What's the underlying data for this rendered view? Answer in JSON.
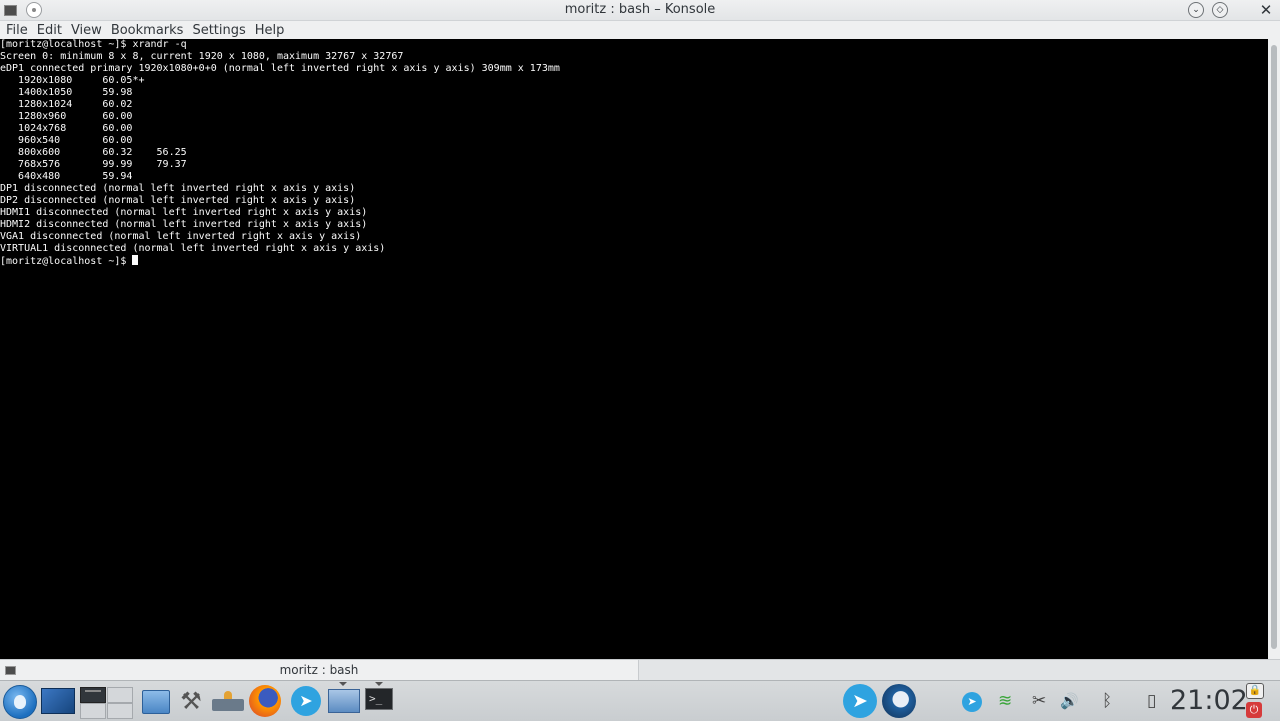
{
  "window": {
    "title": "moritz : bash – Konsole",
    "close_glyph": "✕",
    "minimize_glyph": "⌄",
    "maximize_glyph": "◇"
  },
  "menubar": {
    "items": [
      "File",
      "Edit",
      "View",
      "Bookmarks",
      "Settings",
      "Help"
    ]
  },
  "terminal": {
    "lines": [
      "[moritz@localhost ~]$ xrandr -q",
      "Screen 0: minimum 8 x 8, current 1920 x 1080, maximum 32767 x 32767",
      "eDP1 connected primary 1920x1080+0+0 (normal left inverted right x axis y axis) 309mm x 173mm",
      "   1920x1080     60.05*+",
      "   1400x1050     59.98",
      "   1280x1024     60.02",
      "   1280x960      60.00",
      "   1024x768      60.00",
      "   960x540       60.00",
      "   800x600       60.32    56.25",
      "   768x576       99.99    79.37",
      "   640x480       59.94",
      "DP1 disconnected (normal left inverted right x axis y axis)",
      "DP2 disconnected (normal left inverted right x axis y axis)",
      "HDMI1 disconnected (normal left inverted right x axis y axis)",
      "HDMI2 disconnected (normal left inverted right x axis y axis)",
      "VGA1 disconnected (normal left inverted right x axis y axis)",
      "VIRTUAL1 disconnected (normal left inverted right x axis y axis)"
    ],
    "prompt": "[moritz@localhost ~]$ "
  },
  "tabs": [
    {
      "label": "moritz : bash"
    }
  ],
  "panel": {
    "clock": "21:02",
    "icons": {
      "telegram": "➤",
      "settings": "⚒",
      "wifi": "≋",
      "clipboard": "✂",
      "volume": "🔊",
      "bluetooth": "ᛒ",
      "battery": "▯",
      "lock": "🔒",
      "power": "⏻",
      "konsole": ">_"
    }
  },
  "colors": {
    "terminal_bg": "#000000",
    "terminal_fg": "#fcfcfc",
    "chrome_bg": "#eff0f1",
    "accent": "#2fa3e0"
  }
}
